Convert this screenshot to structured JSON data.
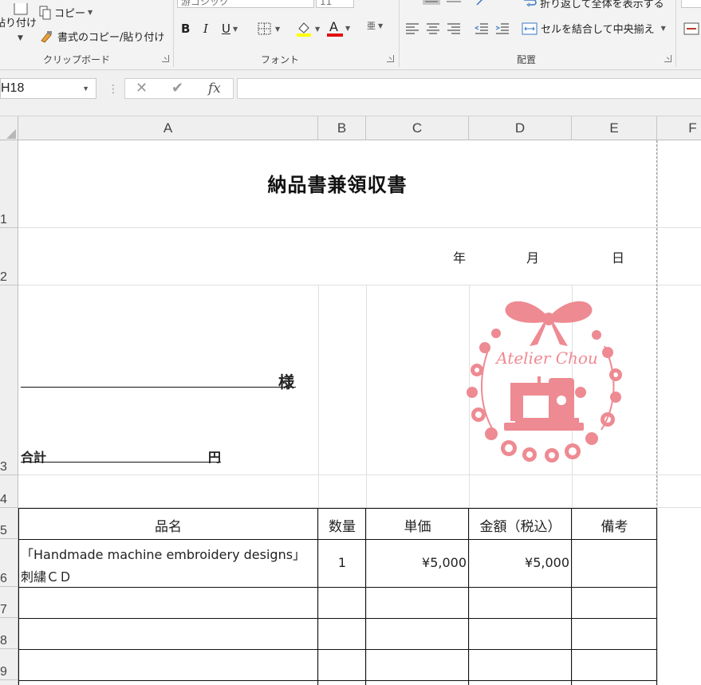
{
  "ribbon": {
    "clipboard": {
      "paste_label": "貼り付け",
      "copy_label": "コピー",
      "format_painter_label": "書式のコピー/貼り付け",
      "group_label": "クリップボード"
    },
    "font": {
      "font_name": "游ゴシック",
      "font_size": "11",
      "bold": "B",
      "italic": "I",
      "underline": "U",
      "furigana": "亜",
      "font_color_glyph": "A",
      "group_label": "フォント",
      "fill_color": "#ffff00",
      "font_color": "#e01010"
    },
    "alignment": {
      "wrap_text_label": "折り返して全体を表示する",
      "merge_center_label": "セルを結合して中央揃え",
      "group_label": "配置"
    }
  },
  "formula_bar": {
    "name_box": "H18",
    "cancel": "✕",
    "enter": "✔",
    "fx": "fx",
    "formula": ""
  },
  "columns": [
    "A",
    "B",
    "C",
    "D",
    "E",
    "F"
  ],
  "rows": [
    "1",
    "2",
    "3",
    "4",
    "5",
    "6",
    "7",
    "8",
    "9"
  ],
  "sheet": {
    "title": "納品書兼領収書",
    "year": "年",
    "month": "月",
    "day": "日",
    "customer_suffix": "様",
    "total_label": "合計",
    "total_yen": "円",
    "headers": [
      "品名",
      "数量",
      "単価",
      "金額（税込）",
      "備考"
    ],
    "items": [
      {
        "name_line1": "「Handmade machine embroidery designs」",
        "name_line2": "刺繍ＣＤ",
        "qty": "1",
        "unit_price": "¥5,000",
        "amount": "¥5,000",
        "note": ""
      }
    ],
    "logo_text": "Atelier Chou",
    "logo_color": "#ee8a92"
  }
}
